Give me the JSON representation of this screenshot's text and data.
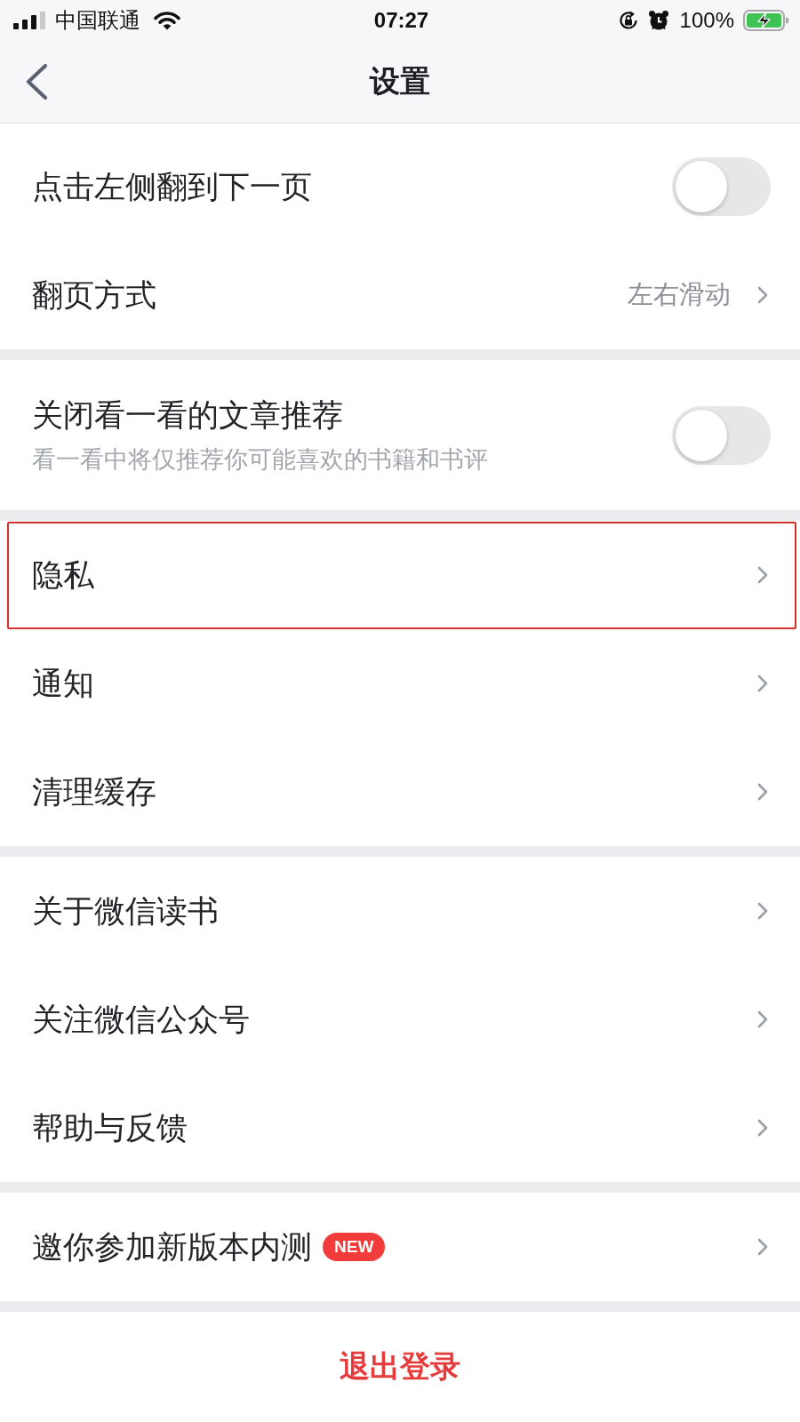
{
  "status_bar": {
    "carrier": "中国联通",
    "time": "07:27",
    "battery": "100%"
  },
  "nav_bar": {
    "title": "设置"
  },
  "sections": [
    {
      "rows": [
        {
          "kind": "toggle",
          "label": "点击左侧翻到下一页",
          "on": false,
          "highlighted": false
        },
        {
          "kind": "link",
          "label": "翻页方式",
          "value": "左右滑动",
          "highlighted": false
        }
      ]
    },
    {
      "rows": [
        {
          "kind": "toggle",
          "label": "关闭看一看的文章推荐",
          "subtitle": "看一看中将仅推荐你可能喜欢的书籍和书评",
          "on": false,
          "highlighted": false
        }
      ]
    },
    {
      "rows": [
        {
          "kind": "link",
          "label": "隐私",
          "highlighted": true
        },
        {
          "kind": "link",
          "label": "通知",
          "highlighted": false
        },
        {
          "kind": "link",
          "label": "清理缓存",
          "highlighted": false
        }
      ]
    },
    {
      "rows": [
        {
          "kind": "link",
          "label": "关于微信读书",
          "highlighted": false
        },
        {
          "kind": "link",
          "label": "关注微信公众号",
          "highlighted": false
        },
        {
          "kind": "link",
          "label": "帮助与反馈",
          "highlighted": false
        }
      ]
    },
    {
      "rows": [
        {
          "kind": "link",
          "label": "邀你参加新版本内测",
          "badge": "NEW",
          "highlighted": false
        }
      ]
    }
  ],
  "logout": {
    "label": "退出登录"
  }
}
